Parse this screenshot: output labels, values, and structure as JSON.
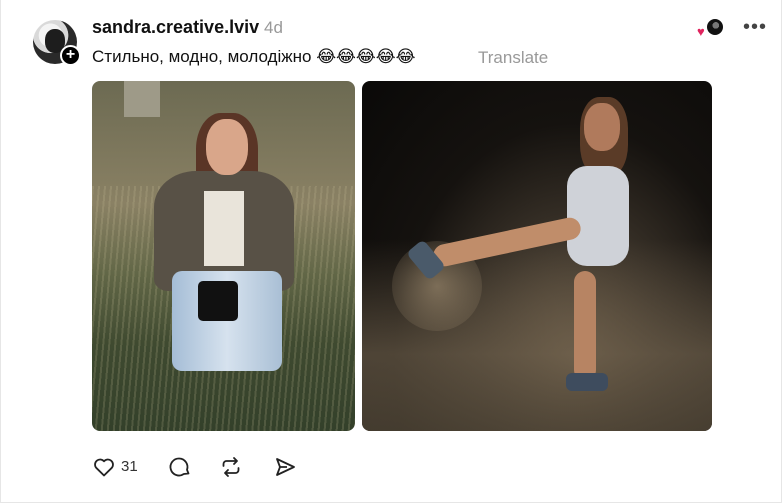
{
  "post": {
    "username": "sandra.creative.lviv",
    "timestamp": "4d",
    "caption": "Стильно, модно, молодіжно 😂😂😂😂😂",
    "translate_label": "Translate",
    "likes": "31",
    "follow_symbol": "+",
    "more_symbol": "•••"
  },
  "icons": {
    "like": "heart-icon",
    "comment": "comment-icon",
    "repost": "repost-icon",
    "share": "send-icon"
  },
  "colors": {
    "reaction_heart": "#e0245e",
    "secondary_text": "#999999"
  }
}
